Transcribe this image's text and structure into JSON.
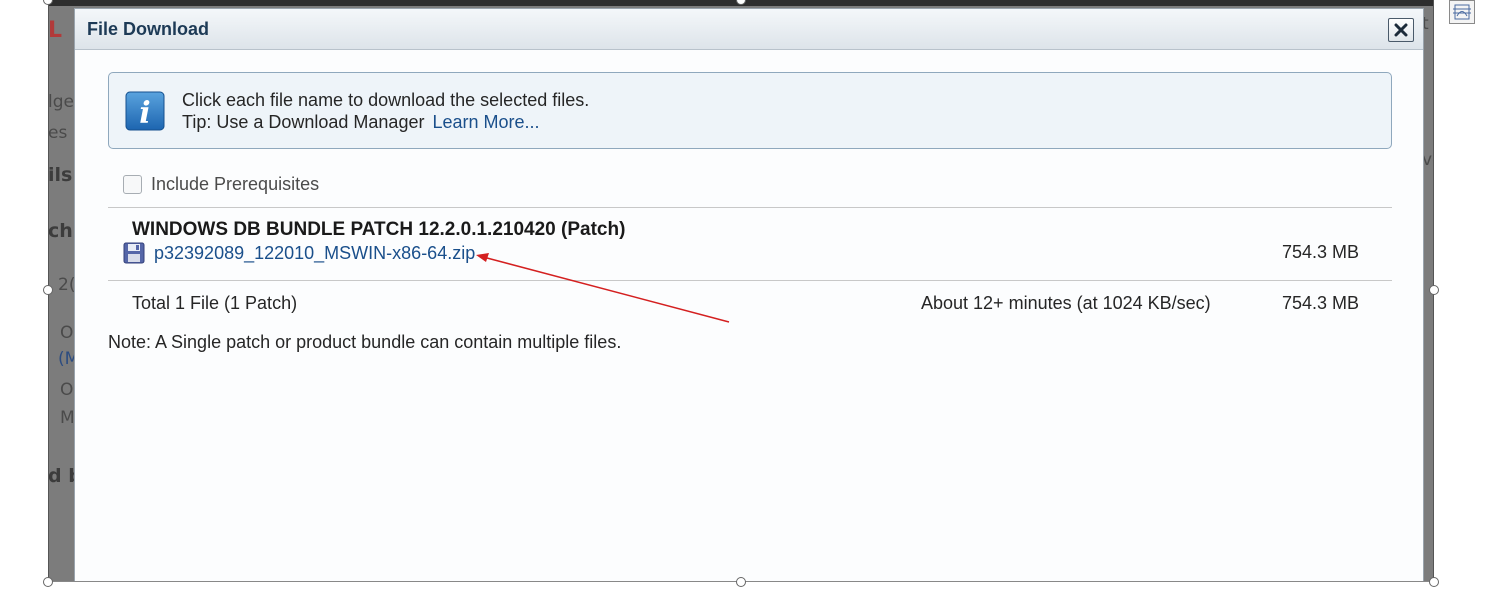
{
  "background_page": {
    "fragments": [
      "L",
      "lge",
      "es",
      "ils",
      "ch",
      "2(",
      "O",
      "(M",
      "O",
      "M",
      "d b",
      "t",
      "ve"
    ]
  },
  "dialog": {
    "title": "File Download",
    "close_icon": "close-icon",
    "info": {
      "icon": "info-icon",
      "line1": "Click each file name to download the selected files.",
      "line2_prefix": "Tip: Use a Download Manager",
      "learn_more": "Learn More..."
    },
    "prerequisites": {
      "label": "Include Prerequisites",
      "checked": false
    },
    "patch": {
      "title": "WINDOWS DB BUNDLE PATCH 12.2.0.1.210420 (Patch)",
      "file_icon": "floppy-disk-icon",
      "file_name": "p32392089_122010_MSWIN-x86-64.zip",
      "file_size": "754.3 MB"
    },
    "total": {
      "label": "Total 1 File (1 Patch)",
      "time": "About 12+ minutes (at 1024 KB/sec)",
      "size": "754.3 MB"
    },
    "note": "Note: A Single patch or product bundle can contain multiple files."
  },
  "colors": {
    "link": "#1a4f8b",
    "title": "#1d3a56",
    "annotation_arrow": "#d42020"
  }
}
